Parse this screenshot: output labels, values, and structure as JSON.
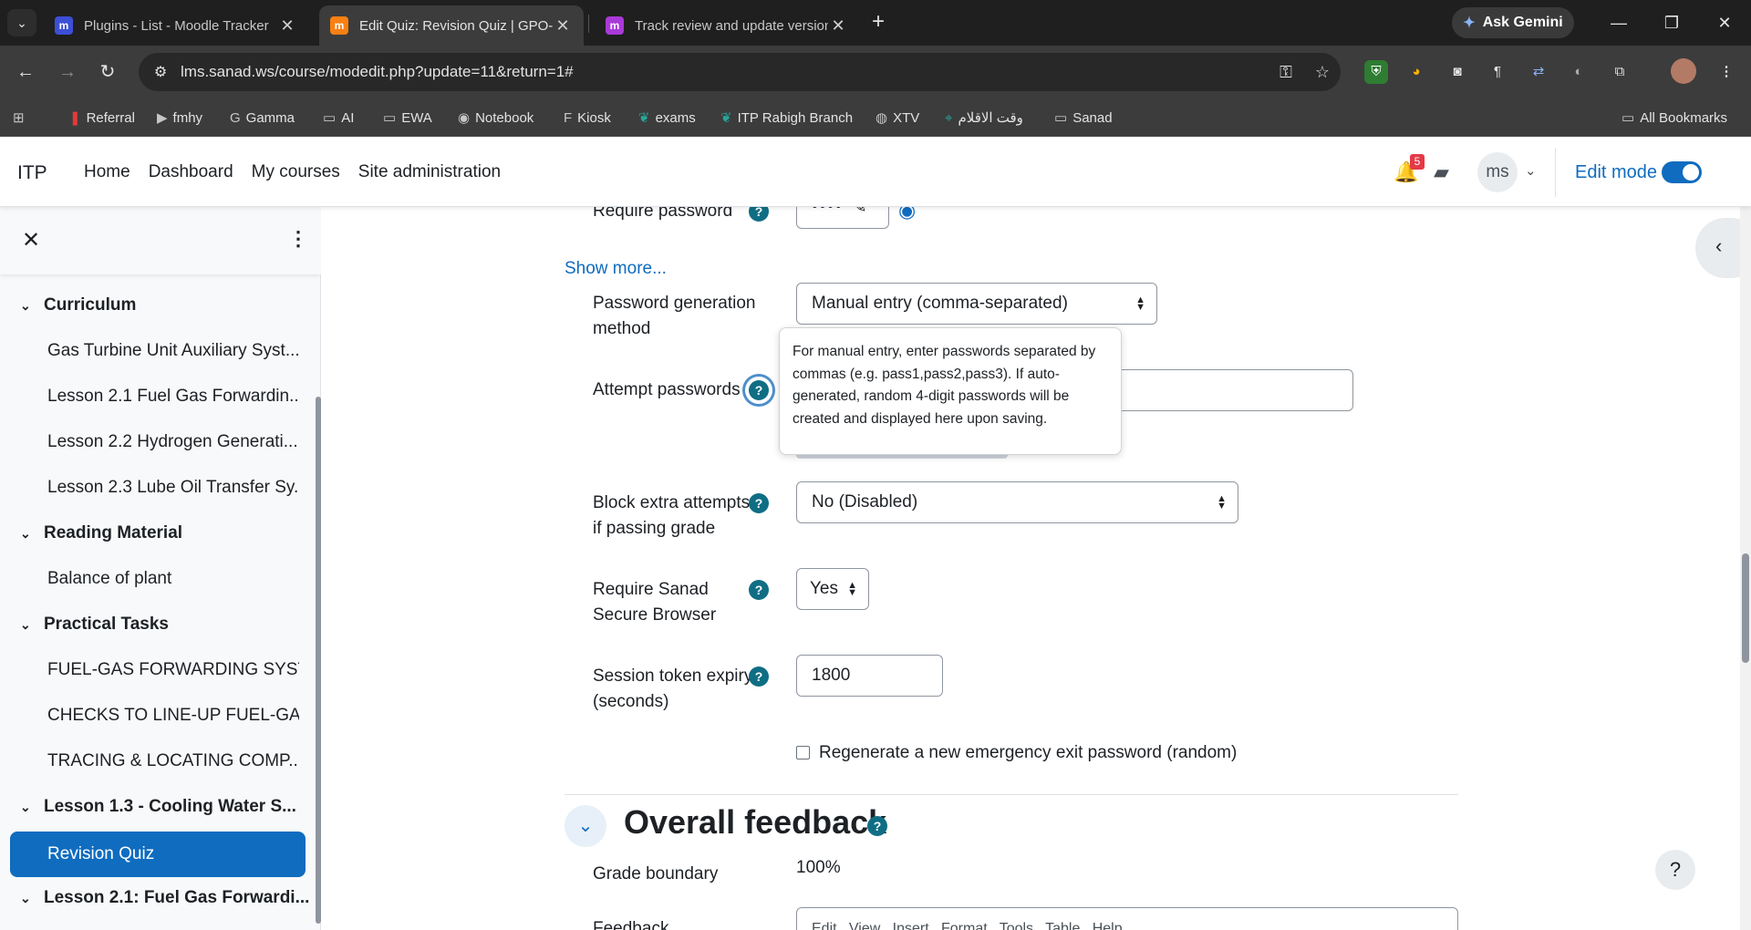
{
  "browser": {
    "tabs": [
      {
        "title": "Plugins - List - Moodle Tracker",
        "favicon": "m",
        "favicon_color": "#3d4fd6"
      },
      {
        "title": "Edit Quiz: Revision Quiz | GPO-(",
        "favicon": "m",
        "favicon_color": "#f98012"
      },
      {
        "title": "Track review and update version",
        "favicon": "m",
        "favicon_color": "#a93ad8"
      }
    ],
    "gemini_label": "Ask Gemini",
    "url": "lms.sanad.ws/course/modedit.php?update=11&return=1#",
    "bookmarks": [
      "Referral",
      "fmhy",
      "Gamma",
      "AI",
      "EWA",
      "Notebook",
      "Kiosk",
      "exams",
      "ITP Rabigh Branch",
      "XTV",
      "وقت الاقلام",
      "Sanad"
    ],
    "all_bookmarks_label": "All Bookmarks"
  },
  "navbar": {
    "brand": "ITP",
    "links": [
      "Home",
      "Dashboard",
      "My courses",
      "Site administration"
    ],
    "notification_count": "5",
    "avatar_initials": "ms",
    "edit_mode_label": "Edit mode",
    "edit_mode_on": true
  },
  "course_index": {
    "sections": [
      {
        "title": "Curriculum",
        "items": [
          "Gas Turbine Unit Auxiliary Syst...",
          "Lesson 2.1 Fuel Gas Forwardin...",
          "Lesson 2.2 Hydrogen Generati...",
          "Lesson 2.3 Lube Oil Transfer Sy..."
        ]
      },
      {
        "title": "Reading Material",
        "items": [
          "Balance of plant"
        ]
      },
      {
        "title": "Practical Tasks",
        "items": [
          "FUEL-GAS FORWARDING SYST...",
          "CHECKS TO LINE-UP FUEL-GAS...",
          "TRACING & LOCATING COMP..."
        ]
      },
      {
        "title": "Lesson 1.3 - Cooling Water S...",
        "items": [
          "Revision Quiz"
        ]
      },
      {
        "title": "Lesson 2.1: Fuel Gas Forwardi...",
        "items": []
      }
    ],
    "current_item": "Revision Quiz"
  },
  "form": {
    "require_password": {
      "label": "Require password",
      "value": "••••"
    },
    "show_more": "Show more...",
    "password_generation": {
      "label_line1": "Password generation",
      "label_line2": "method",
      "value": "Manual entry (comma-separated)"
    },
    "attempt_passwords": {
      "label": "Attempt passwords",
      "value": ""
    },
    "tooltip": "For manual entry, enter passwords separated by commas (e.g. pass1,pass2,pass3). If auto-generated, random 4-digit passwords will be created and displayed here upon saving.",
    "block_extra": {
      "label_line1": "Block extra attempts",
      "label_line2": "if passing grade",
      "value": "No (Disabled)"
    },
    "secure_browser": {
      "label_line1": "Require Sanad",
      "label_line2": "Secure Browser",
      "value": "Yes"
    },
    "token_expiry": {
      "label_line1": "Session token expiry",
      "label_line2": "(seconds)",
      "value": "1800"
    },
    "regenerate_checkbox": {
      "label": "Regenerate a new emergency exit password (random)",
      "checked": false
    },
    "overall_feedback": {
      "title": "Overall feedback",
      "grade_boundary_label": "Grade boundary",
      "grade_boundary_value": "100%",
      "feedback_label": "Feedback",
      "editor_menu": "Edit   View   Insert   Format   Tools   Table   Help"
    }
  }
}
